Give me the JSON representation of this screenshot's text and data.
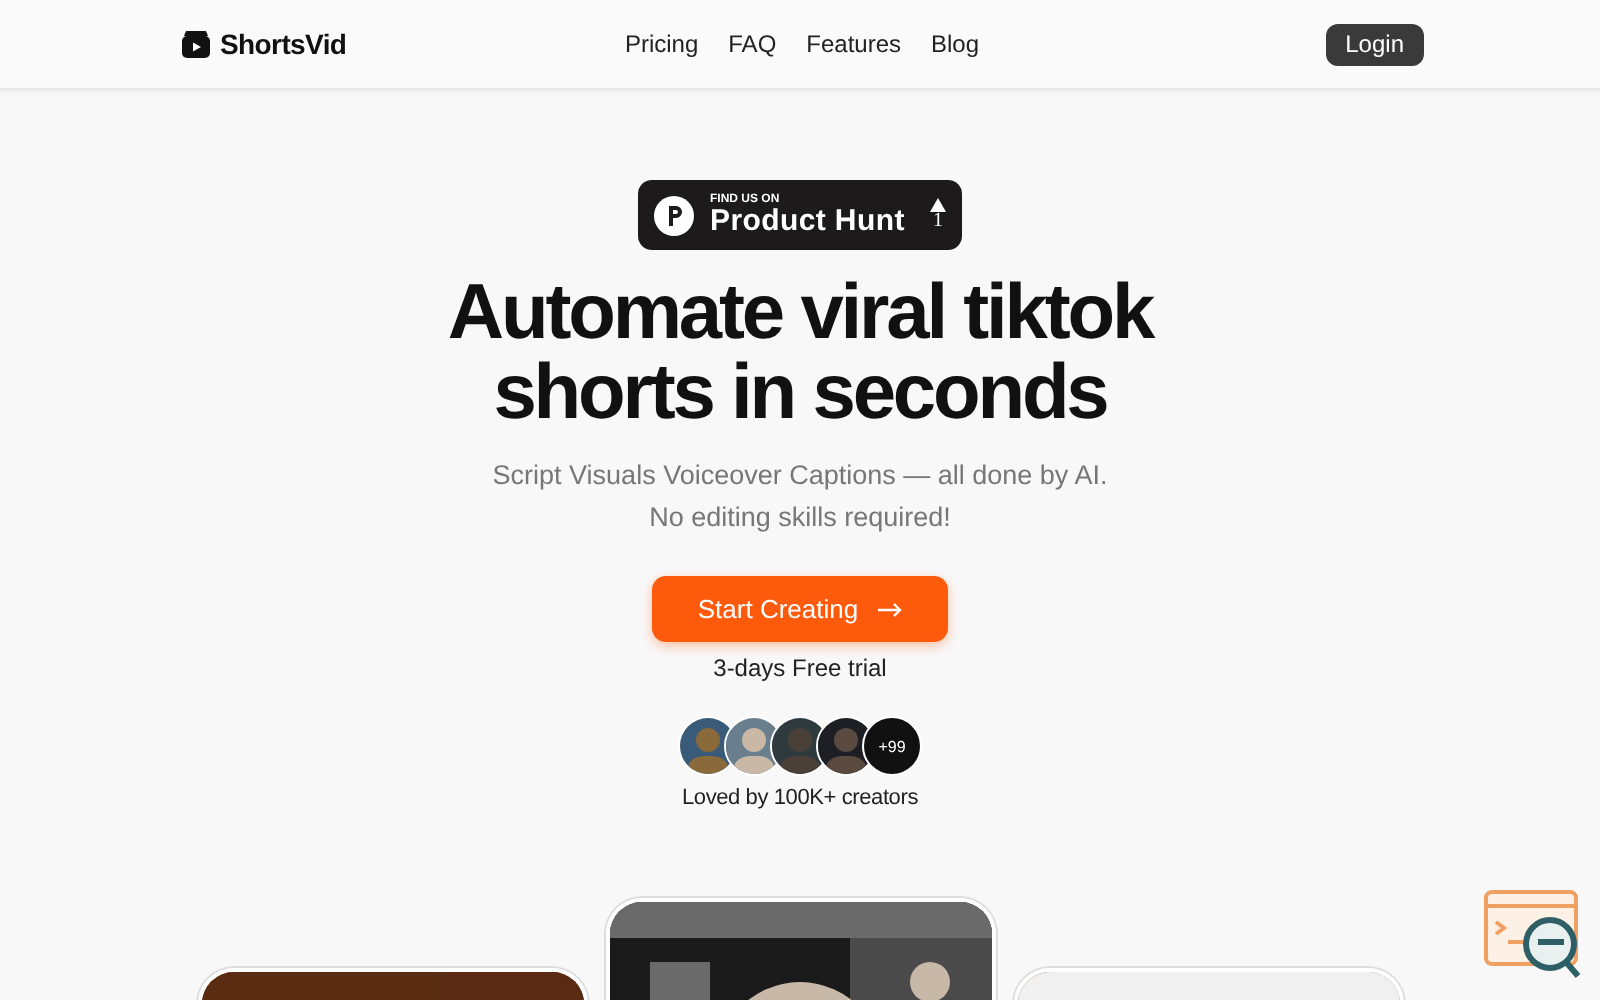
{
  "header": {
    "brand": "ShortsVid",
    "nav": [
      {
        "label": "Pricing"
      },
      {
        "label": "FAQ"
      },
      {
        "label": "Features"
      },
      {
        "label": "Blog"
      }
    ],
    "login": "Login"
  },
  "badge": {
    "eyebrow": "FIND US ON",
    "name": "Product Hunt",
    "votes": "1"
  },
  "hero": {
    "headline_lines": [
      "Automate viral tiktok",
      "shorts in seconds"
    ],
    "subtitle_lines": [
      "Script Visuals Voiceover Captions — all done by AI.",
      "No editing skills required!"
    ],
    "cta": "Start Creating",
    "trial": "3-days Free trial"
  },
  "social_proof": {
    "avatars": [
      {
        "kind": "picture"
      },
      {
        "kind": "picture"
      },
      {
        "kind": "picture"
      },
      {
        "kind": "picture"
      }
    ],
    "more": "+99",
    "caption": "Loved by 100K+ creators"
  },
  "videos": [
    {
      "kind": "picture",
      "raised": false
    },
    {
      "kind": "picture",
      "raised": true
    },
    {
      "kind": "picture",
      "raised": false
    }
  ]
}
